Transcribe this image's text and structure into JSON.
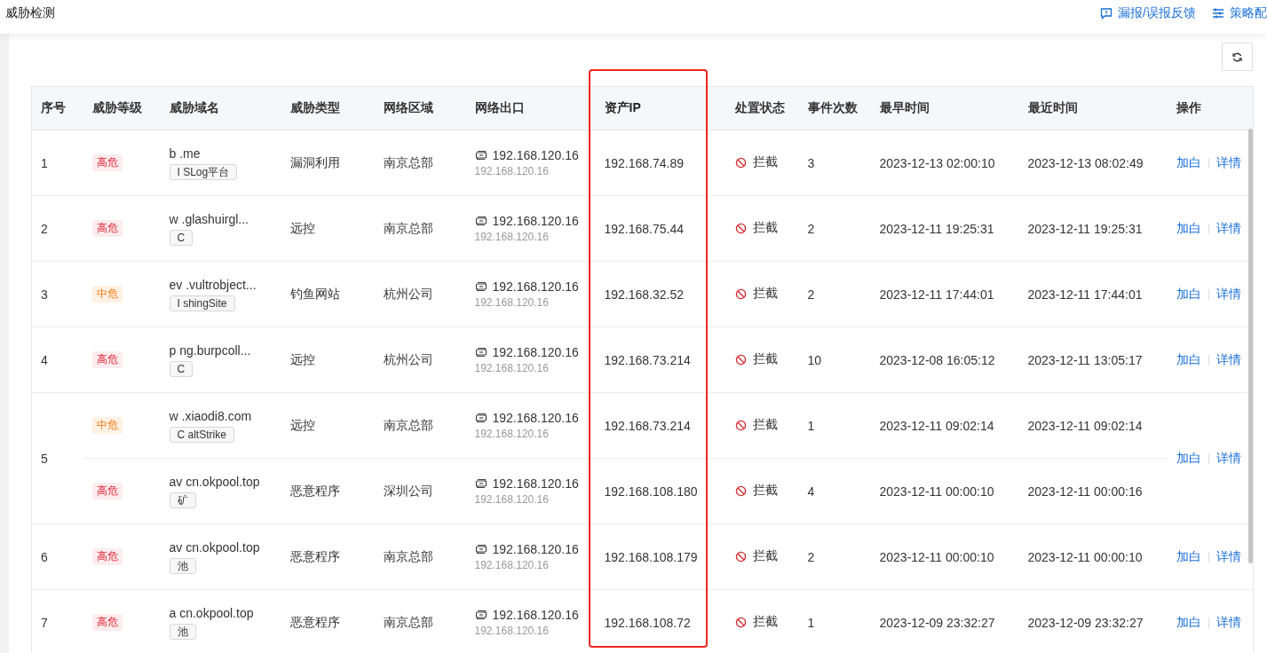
{
  "page_title": "威胁检测",
  "header_actions": [
    {
      "kind": "feedback",
      "label": "漏报/误报反馈"
    },
    {
      "kind": "policy",
      "label": "策略配"
    }
  ],
  "table": {
    "columns": [
      {
        "label": "序号",
        "highlighted": false
      },
      {
        "label": "威胁等级",
        "highlighted": false
      },
      {
        "label": "威胁域名",
        "highlighted": false
      },
      {
        "label": "威胁类型",
        "highlighted": false
      },
      {
        "label": "网络区域",
        "highlighted": false
      },
      {
        "label": "网络出口",
        "highlighted": false
      },
      {
        "label": "资产IP",
        "highlighted": true
      },
      {
        "label": "处置状态",
        "highlighted": false
      },
      {
        "label": "事件次数",
        "highlighted": false
      },
      {
        "label": "最早时间",
        "highlighted": false
      },
      {
        "label": "最近时间",
        "highlighted": false
      },
      {
        "label": "操作",
        "highlighted": false
      }
    ],
    "groups": [
      {
        "index": "1",
        "actions": [
          "加白",
          "详情"
        ],
        "rows": [
          {
            "level": {
              "kind": "high",
              "label": "高危"
            },
            "domain": "b .me",
            "tag": "I SLog平台",
            "type": "漏洞利用",
            "zone": "南京总部",
            "exit": "192.168.120.16",
            "exit_sub": "192.168.120.16",
            "ip": "192.168.74.89",
            "status": {
              "kind": "blocked",
              "label": "拦截"
            },
            "count": "3",
            "first": "2023-12-13 02:00:10",
            "last": "2023-12-13 08:02:49"
          }
        ]
      },
      {
        "index": "2",
        "actions": [
          "加白",
          "详情"
        ],
        "rows": [
          {
            "level": {
              "kind": "high",
              "label": "高危"
            },
            "domain": "w .glashuirgl...",
            "tag": "C",
            "type": "远控",
            "zone": "南京总部",
            "exit": "192.168.120.16",
            "exit_sub": "192.168.120.16",
            "ip": "192.168.75.44",
            "status": {
              "kind": "blocked",
              "label": "拦截"
            },
            "count": "2",
            "first": "2023-12-11 19:25:31",
            "last": "2023-12-11 19:25:31"
          }
        ]
      },
      {
        "index": "3",
        "actions": [
          "加白",
          "详情"
        ],
        "rows": [
          {
            "level": {
              "kind": "medium",
              "label": "中危"
            },
            "domain": "ev .vultrobject...",
            "tag": "I shingSite",
            "type": "钓鱼网站",
            "zone": "杭州公司",
            "exit": "192.168.120.16",
            "exit_sub": "192.168.120.16",
            "ip": "192.168.32.52",
            "status": {
              "kind": "blocked",
              "label": "拦截"
            },
            "count": "2",
            "first": "2023-12-11 17:44:01",
            "last": "2023-12-11 17:44:01"
          }
        ]
      },
      {
        "index": "4",
        "actions": [
          "加白",
          "详情"
        ],
        "rows": [
          {
            "level": {
              "kind": "high",
              "label": "高危"
            },
            "domain": "p ng.burpcoll...",
            "tag": "C",
            "type": "远控",
            "zone": "杭州公司",
            "exit": "192.168.120.16",
            "exit_sub": "192.168.120.16",
            "ip": "192.168.73.214",
            "status": {
              "kind": "blocked",
              "label": "拦截"
            },
            "count": "10",
            "first": "2023-12-08 16:05:12",
            "last": "2023-12-11 13:05:17"
          }
        ]
      },
      {
        "index": "5",
        "actions": [
          "加白",
          "详情"
        ],
        "rows": [
          {
            "level": {
              "kind": "medium",
              "label": "中危"
            },
            "domain": "w .xiaodi8.com",
            "tag": "C altStrike",
            "type": "远控",
            "zone": "南京总部",
            "exit": "192.168.120.16",
            "exit_sub": "192.168.120.16",
            "ip": "192.168.73.214",
            "status": {
              "kind": "blocked",
              "label": "拦截"
            },
            "count": "1",
            "first": "2023-12-11 09:02:14",
            "last": "2023-12-11 09:02:14"
          },
          {
            "level": {
              "kind": "high",
              "label": "高危"
            },
            "domain": "av cn.okpool.top",
            "tag": "矿",
            "type": "恶意程序",
            "zone": "深圳公司",
            "exit": "192.168.120.16",
            "exit_sub": "192.168.120.16",
            "ip": "192.168.108.180",
            "status": {
              "kind": "blocked",
              "label": "拦截"
            },
            "count": "4",
            "first": "2023-12-11 00:00:10",
            "last": "2023-12-11 00:00:16"
          }
        ]
      },
      {
        "index": "6",
        "actions": [
          "加白",
          "详情"
        ],
        "rows": [
          {
            "level": {
              "kind": "high",
              "label": "高危"
            },
            "domain": "av cn.okpool.top",
            "tag": "池",
            "type": "恶意程序",
            "zone": "南京总部",
            "exit": "192.168.120.16",
            "exit_sub": "192.168.120.16",
            "ip": "192.168.108.179",
            "status": {
              "kind": "blocked",
              "label": "拦截"
            },
            "count": "2",
            "first": "2023-12-11 00:00:10",
            "last": "2023-12-11 00:00:10"
          }
        ]
      },
      {
        "index": "7",
        "actions": [
          "加白",
          "详情"
        ],
        "rows": [
          {
            "level": {
              "kind": "high",
              "label": "高危"
            },
            "domain": "a cn.okpool.top",
            "tag": "池",
            "type": "恶意程序",
            "zone": "南京总部",
            "exit": "192.168.120.16",
            "exit_sub": "192.168.120.16",
            "ip": "192.168.108.72",
            "status": {
              "kind": "blocked",
              "label": "拦截"
            },
            "count": "1",
            "first": "2023-12-09 23:32:27",
            "last": "2023-12-09 23:32:27"
          }
        ]
      }
    ]
  }
}
